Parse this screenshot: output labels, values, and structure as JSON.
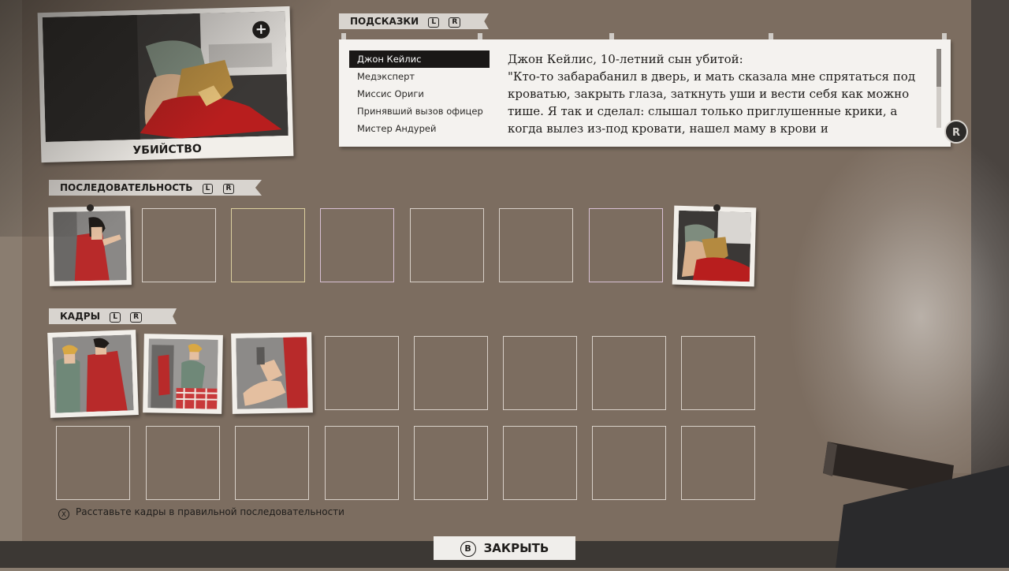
{
  "main_photo": {
    "caption": "УБИЙСТВО"
  },
  "hints": {
    "title": "ПОДСКАЗКИ",
    "btn_l": "L",
    "btn_r": "R",
    "items": [
      {
        "label": "Джон Кейлис"
      },
      {
        "label": "Медэксперт"
      },
      {
        "label": "Миссис Ориги"
      },
      {
        "label": "Принявший вызов офицер"
      },
      {
        "label": "Мистер Андурей"
      }
    ],
    "text": "Джон Кейлис, 10-летний сын убитой:\n\"Кто-то забарабанил в дверь, и мать сказала мне спрятаться под кроватью, закрыть глаза, заткнуть уши и вести себя как можно тише. Я так и сделал: слышал только приглушенные крики, а когда вылез из-под кровати, нашел маму в крови и",
    "scroll_glyph": "R"
  },
  "sequence": {
    "title": "ПОСЛЕДОВАТЕЛЬНОСТЬ",
    "btn_l": "L",
    "btn_r": "R"
  },
  "frames": {
    "title": "КАДРЫ",
    "btn_l": "L",
    "btn_r": "R"
  },
  "footer": {
    "hint_glyph": "X",
    "hint_text": "Расставьте кадры в правильной последовательности",
    "close_glyph": "B",
    "close_label": "ЗАКРЫТЬ"
  }
}
